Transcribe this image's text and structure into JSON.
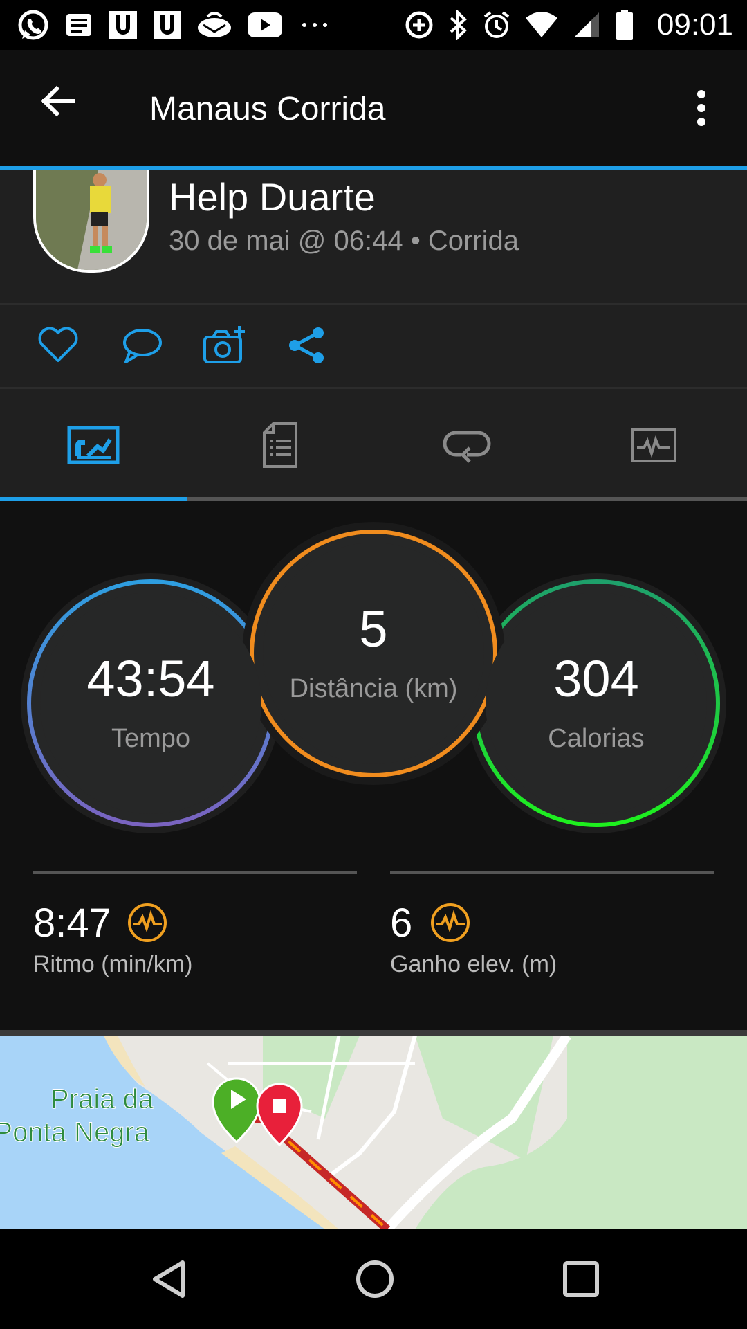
{
  "status_bar": {
    "time": "09:01",
    "icons_left": [
      "whatsapp-icon",
      "news-icon",
      "u-icon",
      "u-icon",
      "mail-icon",
      "youtube-icon",
      "more-dots-icon"
    ],
    "icons_right": [
      "data-saver-icon",
      "bluetooth-icon",
      "alarm-icon",
      "wifi-icon",
      "signal-icon",
      "battery-icon"
    ]
  },
  "app_bar": {
    "title": "Manaus Corrida"
  },
  "profile": {
    "name": "Help Duarte",
    "meta": "30 de mai @ 06:44 • Corrida"
  },
  "actions": [
    "like",
    "comment",
    "add-photo",
    "share"
  ],
  "tabs": [
    {
      "name": "overview",
      "active": true
    },
    {
      "name": "details",
      "active": false
    },
    {
      "name": "laps",
      "active": false
    },
    {
      "name": "charts",
      "active": false
    }
  ],
  "colors": {
    "accent": "#1e9fe8",
    "tempo_ring": [
      "#2e9ee0",
      "#7a63c0"
    ],
    "distance_ring": "#f08c1e",
    "calories_ring": [
      "#1ea06b",
      "#1ef01e"
    ],
    "metric_icon": "#f0a020"
  },
  "stats": {
    "tempo": {
      "value": "43:54",
      "label": "Tempo"
    },
    "distance": {
      "value": "5",
      "label": "Distância (km)"
    },
    "calories": {
      "value": "304",
      "label": "Calorias"
    },
    "pace": {
      "value": "8:47",
      "label": "Ritmo (min/km)"
    },
    "elevation": {
      "value": "6",
      "label": "Ganho elev. (m)"
    }
  },
  "map": {
    "place_line1": "Praia da",
    "place_line2": "Ponta Negra"
  },
  "nav_bar": [
    "back-nav",
    "home-nav",
    "recents-nav"
  ]
}
